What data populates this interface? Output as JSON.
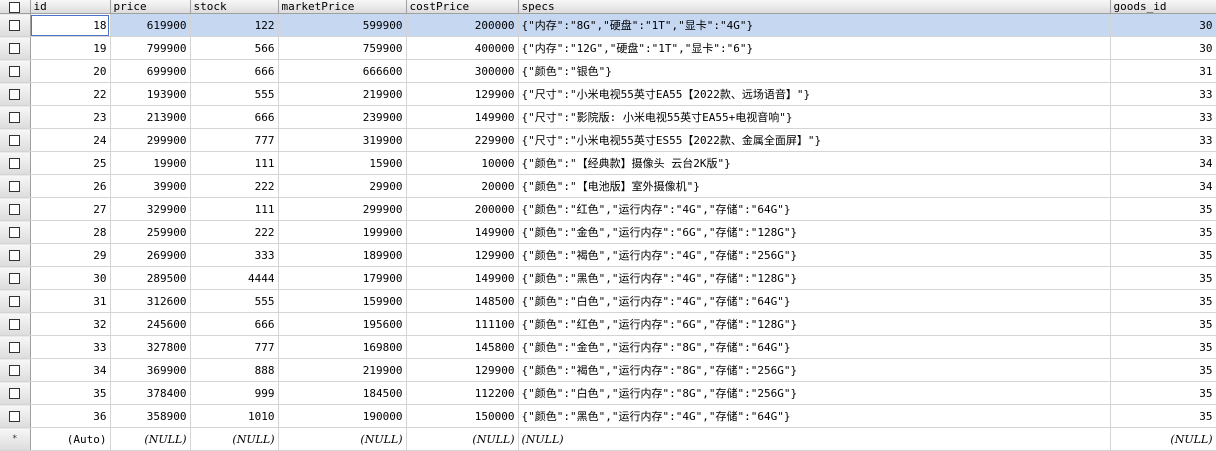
{
  "columns": [
    "id",
    "price",
    "stock",
    "marketPrice",
    "costPrice",
    "specs",
    "goods_id"
  ],
  "rows": [
    {
      "id": "18",
      "price": "619900",
      "stock": "122",
      "marketPrice": "599900",
      "costPrice": "200000",
      "specs": "{\"内存\":\"8G\",\"硬盘\":\"1T\",\"显卡\":\"4G\"}",
      "goods_id": "30"
    },
    {
      "id": "19",
      "price": "799900",
      "stock": "566",
      "marketPrice": "759900",
      "costPrice": "400000",
      "specs": "{\"内存\":\"12G\",\"硬盘\":\"1T\",\"显卡\":\"6\"}",
      "goods_id": "30"
    },
    {
      "id": "20",
      "price": "699900",
      "stock": "666",
      "marketPrice": "666600",
      "costPrice": "300000",
      "specs": "{\"颜色\":\"银色\"}",
      "goods_id": "31"
    },
    {
      "id": "22",
      "price": "193900",
      "stock": "555",
      "marketPrice": "219900",
      "costPrice": "129900",
      "specs": "{\"尺寸\":\"小米电视55英寸EA55【2022款、远场语音】\"}",
      "goods_id": "33"
    },
    {
      "id": "23",
      "price": "213900",
      "stock": "666",
      "marketPrice": "239900",
      "costPrice": "149900",
      "specs": "{\"尺寸\":\"影院版: 小米电视55英寸EA55+电视音响\"}",
      "goods_id": "33"
    },
    {
      "id": "24",
      "price": "299900",
      "stock": "777",
      "marketPrice": "319900",
      "costPrice": "229900",
      "specs": "{\"尺寸\":\"小米电视55英寸ES55【2022款、金属全面屏】\"}",
      "goods_id": "33"
    },
    {
      "id": "25",
      "price": "19900",
      "stock": "111",
      "marketPrice": "15900",
      "costPrice": "10000",
      "specs": "{\"颜色\":\"【经典款】摄像头 云台2K版\"}",
      "goods_id": "34"
    },
    {
      "id": "26",
      "price": "39900",
      "stock": "222",
      "marketPrice": "29900",
      "costPrice": "20000",
      "specs": "{\"颜色\":\"【电池版】室外摄像机\"}",
      "goods_id": "34"
    },
    {
      "id": "27",
      "price": "329900",
      "stock": "111",
      "marketPrice": "299900",
      "costPrice": "200000",
      "specs": "{\"颜色\":\"红色\",\"运行内存\":\"4G\",\"存储\":\"64G\"}",
      "goods_id": "35"
    },
    {
      "id": "28",
      "price": "259900",
      "stock": "222",
      "marketPrice": "199900",
      "costPrice": "149900",
      "specs": "{\"颜色\":\"金色\",\"运行内存\":\"6G\",\"存储\":\"128G\"}",
      "goods_id": "35"
    },
    {
      "id": "29",
      "price": "269900",
      "stock": "333",
      "marketPrice": "189900",
      "costPrice": "129900",
      "specs": "{\"颜色\":\"褐色\",\"运行内存\":\"4G\",\"存储\":\"256G\"}",
      "goods_id": "35"
    },
    {
      "id": "30",
      "price": "289500",
      "stock": "4444",
      "marketPrice": "179900",
      "costPrice": "149900",
      "specs": "{\"颜色\":\"黑色\",\"运行内存\":\"4G\",\"存储\":\"128G\"}",
      "goods_id": "35"
    },
    {
      "id": "31",
      "price": "312600",
      "stock": "555",
      "marketPrice": "159900",
      "costPrice": "148500",
      "specs": "{\"颜色\":\"白色\",\"运行内存\":\"4G\",\"存储\":\"64G\"}",
      "goods_id": "35"
    },
    {
      "id": "32",
      "price": "245600",
      "stock": "666",
      "marketPrice": "195600",
      "costPrice": "111100",
      "specs": "{\"颜色\":\"红色\",\"运行内存\":\"6G\",\"存储\":\"128G\"}",
      "goods_id": "35"
    },
    {
      "id": "33",
      "price": "327800",
      "stock": "777",
      "marketPrice": "169800",
      "costPrice": "145800",
      "specs": "{\"颜色\":\"金色\",\"运行内存\":\"8G\",\"存储\":\"64G\"}",
      "goods_id": "35"
    },
    {
      "id": "34",
      "price": "369900",
      "stock": "888",
      "marketPrice": "219900",
      "costPrice": "129900",
      "specs": "{\"颜色\":\"褐色\",\"运行内存\":\"8G\",\"存储\":\"256G\"}",
      "goods_id": "35"
    },
    {
      "id": "35",
      "price": "378400",
      "stock": "999",
      "marketPrice": "184500",
      "costPrice": "112200",
      "specs": "{\"颜色\":\"白色\",\"运行内存\":\"8G\",\"存储\":\"256G\"}",
      "goods_id": "35"
    },
    {
      "id": "36",
      "price": "358900",
      "stock": "1010",
      "marketPrice": "190000",
      "costPrice": "150000",
      "specs": "{\"颜色\":\"黑色\",\"运行内存\":\"4G\",\"存储\":\"64G\"}",
      "goods_id": "35"
    }
  ],
  "new_row": {
    "marker": "*",
    "id": "(Auto)",
    "price": "(NULL)",
    "stock": "(NULL)",
    "marketPrice": "(NULL)",
    "costPrice": "(NULL)",
    "specs": "(NULL)",
    "goods_id": "(NULL)"
  },
  "colors": {
    "selected_row": "#c6d7f2",
    "focus_border": "#4a74c9",
    "header_bg": "#dcdcdc"
  }
}
